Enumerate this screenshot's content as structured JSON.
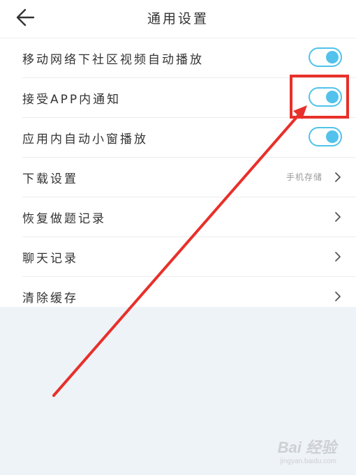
{
  "header": {
    "title": "通用设置",
    "back_icon": "arrow-left-icon"
  },
  "settings": {
    "items": [
      {
        "label": "移动网络下社区视频自动播放",
        "type": "toggle",
        "enabled": true
      },
      {
        "label": "接受APP内通知",
        "type": "toggle",
        "enabled": true
      },
      {
        "label": "应用内自动小窗播放",
        "type": "toggle",
        "enabled": true
      },
      {
        "label": "下载设置",
        "type": "link",
        "value": "手机存储"
      },
      {
        "label": "恢复做题记录",
        "type": "link"
      },
      {
        "label": "聊天记录",
        "type": "link"
      },
      {
        "label": "清除缓存",
        "type": "link"
      }
    ]
  },
  "watermark": {
    "brand": "Bai 经验",
    "url": "jingyan.baidu.com"
  },
  "colors": {
    "toggle_accent": "#4fc3ea",
    "annotation_red": "#e8302a",
    "bottom_background": "#eef3f8"
  }
}
